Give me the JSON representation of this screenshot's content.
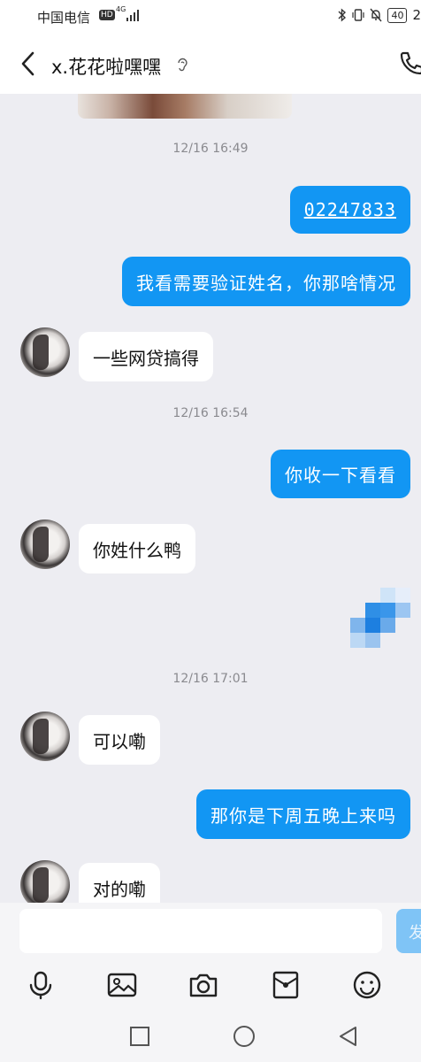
{
  "status_bar": {
    "carrier": "中国电信",
    "hd": "HD",
    "network": "4G",
    "battery": "40",
    "time_partial": "2"
  },
  "header": {
    "title": "x.花花啦嘿嘿"
  },
  "messages": [
    {
      "type": "time",
      "text": "12/16 16:49"
    },
    {
      "type": "out",
      "text": "02247833",
      "link": true
    },
    {
      "type": "out",
      "text": "我看需要验证姓名，你那啥情况"
    },
    {
      "type": "in",
      "text": "一些网贷搞得"
    },
    {
      "type": "time",
      "text": "12/16 16:54"
    },
    {
      "type": "out",
      "text": "你收一下看看"
    },
    {
      "type": "in",
      "text": "你姓什么鸭"
    },
    {
      "type": "out_image",
      "text": ""
    },
    {
      "type": "time",
      "text": "12/16 17:01"
    },
    {
      "type": "in",
      "text": "可以嘞"
    },
    {
      "type": "out",
      "text": "那你是下周五晚上来吗"
    },
    {
      "type": "in",
      "text": "对的嘞"
    }
  ],
  "input": {
    "placeholder": "",
    "send_label": "发"
  },
  "toolbar_icons": [
    "microphone-icon",
    "image-icon",
    "camera-icon",
    "red-packet-icon",
    "emoji-icon"
  ],
  "nav_icons": [
    "recents-square-icon",
    "home-circle-icon",
    "back-triangle-icon"
  ],
  "colors": {
    "accent": "#1296f3",
    "chat_bg": "#ededf2",
    "incoming_bubble": "#ffffff"
  }
}
